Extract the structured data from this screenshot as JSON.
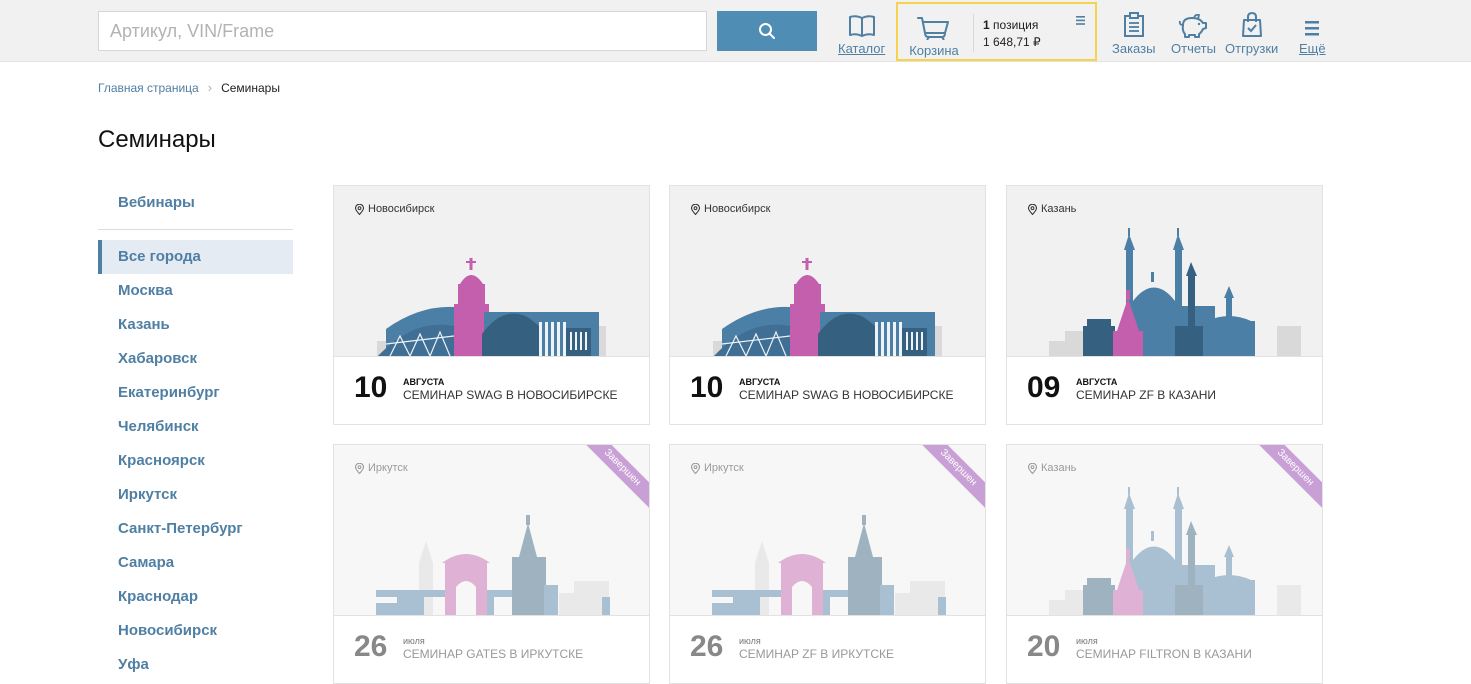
{
  "header": {
    "search_placeholder": "Артикул, VIN/Frame",
    "nav": {
      "catalog": "Каталог",
      "orders": "Заказы",
      "reports": "Отчеты",
      "shipments": "Отгрузки",
      "more": "Ещё"
    },
    "cart": {
      "label": "Корзина",
      "count": "1",
      "count_suffix": "позиция",
      "total": "1 648,71 ₽",
      "highlight_color": "#f5d34d"
    }
  },
  "breadcrumb": {
    "home": "Главная страница",
    "current": "Семинары"
  },
  "page_title": "Семинары",
  "sidebar": {
    "webinars": "Вебинары",
    "cities": [
      "Все города",
      "Москва",
      "Казань",
      "Хабаровск",
      "Екатеринбург",
      "Челябинск",
      "Красноярск",
      "Иркутск",
      "Санкт-Петербург",
      "Самара",
      "Краснодар",
      "Новосибирск",
      "Уфа"
    ]
  },
  "cards": [
    {
      "city": "Новосибирск",
      "day": "10",
      "month": "АВГУСТА",
      "name": "СЕМИНАР SWAG В НОВОСИБИРСКЕ",
      "skyline": "novosibirsk"
    },
    {
      "city": "Новосибирск",
      "day": "10",
      "month": "АВГУСТА",
      "name": "СЕМИНАР SWAG В НОВОСИБИРСКЕ",
      "skyline": "novosibirsk"
    },
    {
      "city": "Казань",
      "day": "09",
      "month": "АВГУСТА",
      "name": "СЕМИНАР ZF В КАЗАНИ",
      "skyline": "kazan"
    },
    {
      "city": "Иркутск",
      "day": "26",
      "month": "июля",
      "name": "СЕМИНАР GATES В ИРКУТСКЕ",
      "skyline": "irkutsk",
      "badge": "Завершен"
    },
    {
      "city": "Иркутск",
      "day": "26",
      "month": "июля",
      "name": "СЕМИНАР ZF В ИРКУТСКЕ",
      "skyline": "irkutsk",
      "badge": "Завершен"
    },
    {
      "city": "Казань",
      "day": "20",
      "month": "июля",
      "name": "СЕМИНАР FILTRON В КАЗАНИ",
      "skyline": "kazan",
      "badge": "Завершен"
    }
  ],
  "colors": {
    "accent": "#4f8db4",
    "link": "#4f7fa3",
    "skyline_blue": "#4b7fa6",
    "skyline_dark": "#35607f",
    "skyline_pink": "#c45fae",
    "skyline_gray": "#d9d9d9",
    "badge": "#c9a0d6"
  }
}
